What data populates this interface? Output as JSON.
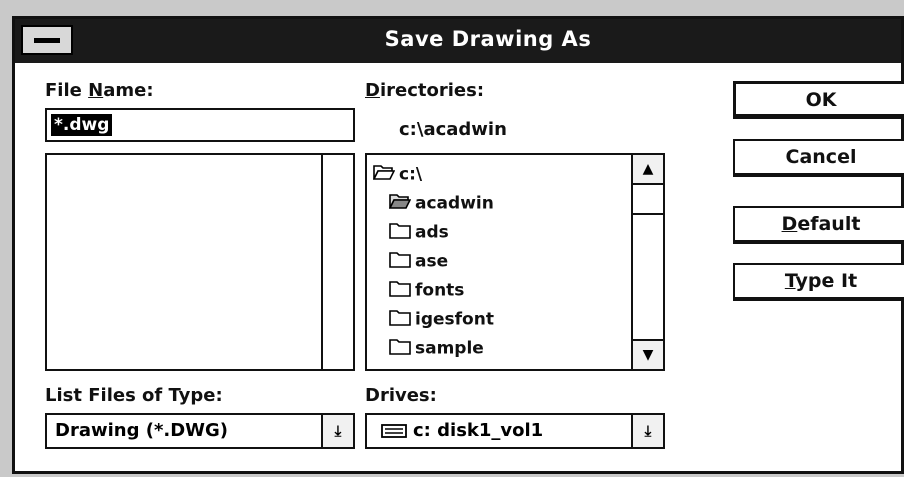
{
  "dialog": {
    "title": "Save Drawing As"
  },
  "file_name": {
    "label_prefix": "File ",
    "label_mnemonic": "N",
    "label_suffix": "ame:",
    "value": "*.dwg"
  },
  "directories": {
    "label_mnemonic": "D",
    "label_rest": "irectories:",
    "current_path": "c:\\acadwin",
    "items": [
      {
        "name": "c:\\",
        "icon": "open-folder-icon"
      },
      {
        "name": "acadwin",
        "icon": "open-folder-icon"
      },
      {
        "name": "ads",
        "icon": "folder-icon"
      },
      {
        "name": "ase",
        "icon": "folder-icon"
      },
      {
        "name": "fonts",
        "icon": "folder-icon"
      },
      {
        "name": "igesfont",
        "icon": "folder-icon"
      },
      {
        "name": "sample",
        "icon": "folder-icon"
      }
    ]
  },
  "list_files": {
    "label": "List Files of Type:",
    "value": "Drawing (*.DWG)"
  },
  "drives": {
    "label": "Drives:",
    "value": "c: disk1_vol1",
    "icon": "drive-icon"
  },
  "buttons": {
    "ok": "OK",
    "cancel": "Cancel",
    "default_mnemonic": "D",
    "default_rest": "efault",
    "type_it_mnemonic": "T",
    "type_it_rest": "ype It"
  }
}
